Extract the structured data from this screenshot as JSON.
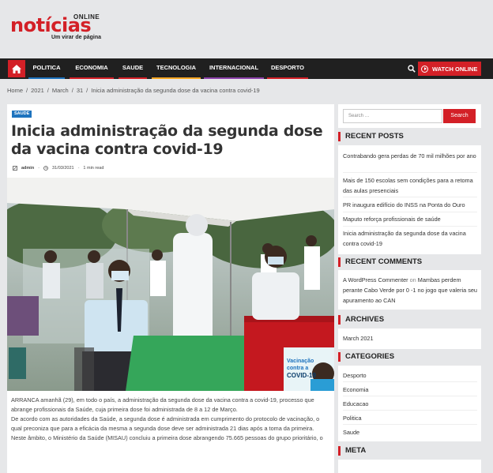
{
  "header": {
    "logo_text": "notícias",
    "logo_online": "ONLINE",
    "tagline": "Um virar de página"
  },
  "nav": {
    "items": [
      {
        "label": "POLITICA",
        "color": "#1e73be"
      },
      {
        "label": "ECONOMIA",
        "color": "#d32027"
      },
      {
        "label": "SAUDE",
        "color": "#d32027"
      },
      {
        "label": "TECNOLOGIA",
        "color": "#f5a623"
      },
      {
        "label": "INTERNACIONAL",
        "color": "#8e44ad"
      },
      {
        "label": "DESPORTO",
        "color": "#d32027"
      }
    ],
    "watch_label": "WATCH ONLINE"
  },
  "breadcrumb": [
    "Home",
    "/",
    "2021",
    "/",
    "March",
    "/",
    "31",
    "/",
    "Inicia administração da segunda dose da vacina contra covid-19"
  ],
  "article": {
    "category": "SAUDE",
    "title": "Inicia administração da segunda dose da vacina contra covid-19",
    "author": "admin",
    "date": "31/03/2021",
    "read_time": "1 min read",
    "paragraphs": [
      "ARRANCA amanhã (29), em todo o país, a administração da segunda dose da vacina contra a covid-19, processo que abrange profissionais da Saúde, cuja primeira dose foi administrada de 8 a 12 de Março.",
      "De acordo com as autoridades da Saúde, a segunda dose é administrada em cumprimento do protocolo de vacinação, o",
      "qual preconiza que para a eficácia da mesma a segunda dose deve ser administrada 21 dias após a toma da primeira.",
      "Neste âmbito, o Ministério da Saúde (MISAU) concluiu a primeira dose abrangendo 75.665 pessoas do grupo prioritário, o"
    ],
    "banner_text": "Vacinação contra a COVID-19"
  },
  "sidebar": {
    "search_placeholder": "Search …",
    "search_button": "Search",
    "recent_posts_title": "RECENT POSTS",
    "recent_posts": [
      "Contrabando gera perdas de 70 mil milhões por ano",
      "Mais de 150 escolas sem condições para a retoma das aulas presenciais",
      "PR inaugura edifício do INSS na Ponta do Ouro",
      "Maputo reforça profissionais de saúde",
      "Inicia administração da segunda dose da vacina contra covid-19"
    ],
    "recent_comments_title": "RECENT COMMENTS",
    "comment": {
      "author": "A WordPress Commenter",
      "on": "on",
      "post": "Mambas perdem perante Cabo Verde por 0 -1 no jogo que valeria seu apuramento ao CAN"
    },
    "archives_title": "ARCHIVES",
    "archives": [
      "March 2021"
    ],
    "categories_title": "CATEGORIES",
    "categories": [
      "Desporto",
      "Economia",
      "Educacao",
      "Politica",
      "Saude"
    ],
    "meta_title": "META"
  }
}
